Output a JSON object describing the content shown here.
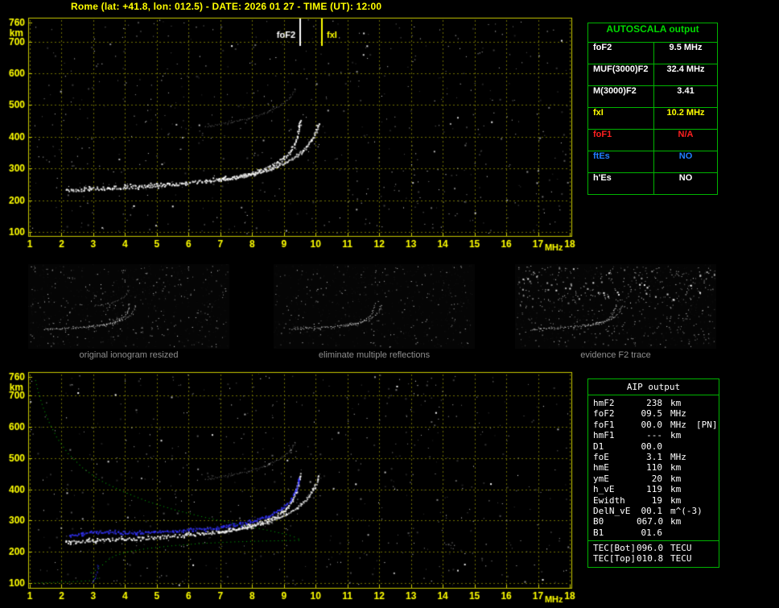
{
  "title": "Rome (lat: +41.8, lon: 012.5) - DATE: 2026 01 27 - TIME (UT): 12:00",
  "colors": {
    "background": "#000000",
    "axis_text": "#ffff00",
    "plot_border": "#c8c800",
    "grid": "#6e6e00",
    "table_green": "#00b400",
    "table_title_green": "#00d800",
    "trace_white": "#ffffff",
    "profile_green": "#00bb00",
    "trace_blue": "#3333ff",
    "caption_gray": "#8f8f8f",
    "red": "#ff2020",
    "blue": "#1f7fff",
    "yellow": "#ffff00"
  },
  "autoscala_table": {
    "title": "AUTOSCALA output",
    "rows": [
      {
        "key": "fof2",
        "label": "foF2",
        "value": "9.5 MHz",
        "color": "#ffffff"
      },
      {
        "key": "muf3000",
        "label": "MUF(3000)F2",
        "value": "32.4 MHz",
        "color": "#ffffff"
      },
      {
        "key": "m3000",
        "label": "M(3000)F2",
        "value": "3.41",
        "color": "#ffffff"
      },
      {
        "key": "fxi",
        "label": "fxI",
        "value": "10.2 MHz",
        "color": "#ffff00"
      },
      {
        "key": "fof1",
        "label": "foF1",
        "value": "N/A",
        "color": "#ff2020"
      },
      {
        "key": "ftes",
        "label": "ftEs",
        "value": "NO",
        "color": "#1f7fff"
      },
      {
        "key": "hes",
        "label": "h'Es",
        "value": "NO",
        "color": "#ffffff"
      }
    ]
  },
  "aip_table": {
    "title": "AIP output",
    "rows": [
      {
        "label": "hmF2",
        "value": "238",
        "unit": "km",
        "extra": ""
      },
      {
        "label": "foF2",
        "value": "09.5",
        "unit": "MHz",
        "extra": ""
      },
      {
        "label": "foF1",
        "value": "00.0",
        "unit": "MHz",
        "extra": "[PN]"
      },
      {
        "label": "hmF1",
        "value": "---",
        "unit": "km",
        "extra": ""
      },
      {
        "label": "D1",
        "value": "00.0",
        "unit": "",
        "extra": ""
      },
      {
        "label": "foE",
        "value": "3.1",
        "unit": "MHz",
        "extra": ""
      },
      {
        "label": "hmE",
        "value": "110",
        "unit": "km",
        "extra": ""
      },
      {
        "label": "ymE",
        "value": "20",
        "unit": "km",
        "extra": ""
      },
      {
        "label": "h_vE",
        "value": "119",
        "unit": "km",
        "extra": ""
      },
      {
        "label": "Ewidth",
        "value": "19",
        "unit": "km",
        "extra": ""
      },
      {
        "label": "DelN_vE",
        "value": "00.1",
        "unit": "m^(-3)",
        "extra": ""
      },
      {
        "label": "B0",
        "value": "067.0",
        "unit": "km",
        "extra": ""
      },
      {
        "label": "B1",
        "value": "01.6",
        "unit": "",
        "extra": ""
      }
    ],
    "tec_rows": [
      {
        "label": "TEC[Bot]",
        "value": "096.0",
        "unit": "TECU",
        "extra": ""
      },
      {
        "label": "TEC[Top]",
        "value": "010.8",
        "unit": "TECU",
        "extra": ""
      }
    ]
  },
  "thumbnails": [
    {
      "caption": "original ionogram resized",
      "seed": 77,
      "noise_count": 300,
      "top_noise_count": 0,
      "show": [
        "f2_ordinary",
        "f2_extraordinary",
        "multiple_reflection"
      ]
    },
    {
      "caption": "eliminate multiple reflections",
      "seed": 99,
      "noise_count": 210,
      "top_noise_count": 0,
      "show": [
        "f2_ordinary",
        "f2_extraordinary"
      ]
    },
    {
      "caption": "evidence F2 trace",
      "seed": 55,
      "noise_count": 380,
      "top_noise_count": 170,
      "show": [
        "f2_ordinary",
        "f2_extraordinary"
      ]
    }
  ],
  "chart_data": {
    "type": "scatter",
    "title": "ionogram",
    "xlabel": "MHz",
    "ylabel": "km",
    "x_range": [
      1,
      18
    ],
    "y_range": [
      100,
      775
    ],
    "x_ticks": [
      1,
      2,
      3,
      4,
      5,
      6,
      7,
      8,
      9,
      10,
      11,
      12,
      13,
      14,
      15,
      16,
      17,
      18
    ],
    "y_ticks": [
      760,
      700,
      600,
      500,
      400,
      300,
      200,
      100
    ],
    "grid": true,
    "annotations": [
      {
        "label": "foF2",
        "freq": 9.5,
        "color": "#ffffff",
        "side": "left"
      },
      {
        "label": "fxI",
        "freq": 10.2,
        "color": "#ffff00",
        "side": "right"
      }
    ],
    "traces": {
      "f2_ordinary": {
        "color": "#ffffff",
        "size": 2,
        "band": 4,
        "alpha": 0.95,
        "points": [
          [
            2.15,
            232
          ],
          [
            2.5,
            235
          ],
          [
            3.0,
            238
          ],
          [
            3.6,
            241
          ],
          [
            4.2,
            244
          ],
          [
            4.8,
            247
          ],
          [
            5.4,
            251
          ],
          [
            6.0,
            256
          ],
          [
            6.6,
            262
          ],
          [
            7.1,
            269
          ],
          [
            7.6,
            278
          ],
          [
            8.0,
            288
          ],
          [
            8.4,
            300
          ],
          [
            8.7,
            314
          ],
          [
            8.95,
            330
          ],
          [
            9.15,
            350
          ],
          [
            9.3,
            374
          ],
          [
            9.4,
            400
          ],
          [
            9.46,
            425
          ],
          [
            9.5,
            448
          ],
          [
            9.52,
            458
          ]
        ]
      },
      "f2_extraordinary": {
        "color": "#ffffff",
        "size": 2,
        "band": 2,
        "alpha": 0.8,
        "points": [
          [
            6.9,
            263
          ],
          [
            7.4,
            271
          ],
          [
            7.9,
            281
          ],
          [
            8.35,
            293
          ],
          [
            8.75,
            307
          ],
          [
            9.1,
            323
          ],
          [
            9.4,
            342
          ],
          [
            9.65,
            364
          ],
          [
            9.85,
            390
          ],
          [
            9.98,
            415
          ],
          [
            10.06,
            436
          ],
          [
            10.1,
            448
          ]
        ]
      },
      "multiple_reflection": {
        "color": "#b8b8b8",
        "size": 1,
        "band": 2,
        "alpha": 0.5,
        "points": [
          [
            6.5,
            432
          ],
          [
            7.0,
            440
          ],
          [
            7.5,
            450
          ],
          [
            8.0,
            462
          ],
          [
            8.4,
            476
          ],
          [
            8.75,
            492
          ],
          [
            9.05,
            512
          ],
          [
            9.25,
            533
          ],
          [
            9.38,
            555
          ]
        ]
      },
      "profile_topside": {
        "color": "#00bb00",
        "size": 1,
        "dotted": true,
        "points": [
          [
            1.15,
            758
          ],
          [
            1.25,
            715
          ],
          [
            1.4,
            665
          ],
          [
            1.6,
            615
          ],
          [
            1.85,
            565
          ],
          [
            2.2,
            515
          ],
          [
            2.65,
            470
          ],
          [
            3.2,
            430
          ],
          [
            3.9,
            395
          ],
          [
            4.7,
            362
          ],
          [
            5.6,
            334
          ],
          [
            6.6,
            309
          ],
          [
            7.6,
            288
          ],
          [
            8.5,
            270
          ],
          [
            9.1,
            256
          ],
          [
            9.4,
            246
          ],
          [
            9.5,
            239
          ]
        ]
      },
      "profile_bottomside": {
        "color": "#00bb00",
        "size": 1,
        "dotted": true,
        "points": [
          [
            1.05,
            101
          ],
          [
            1.7,
            103
          ],
          [
            2.4,
            106
          ],
          [
            2.95,
            109
          ],
          [
            3.1,
            111
          ],
          [
            3.12,
            116
          ],
          [
            2.98,
            121
          ],
          [
            2.88,
            127
          ],
          [
            2.92,
            134
          ],
          [
            3.05,
            142
          ],
          [
            3.2,
            152
          ],
          [
            3.32,
            163
          ],
          [
            3.45,
            176
          ],
          [
            3.7,
            190
          ],
          [
            4.1,
            202
          ],
          [
            4.7,
            212
          ],
          [
            5.5,
            221
          ],
          [
            6.4,
            228
          ],
          [
            7.4,
            233
          ],
          [
            8.4,
            236
          ],
          [
            9.1,
            237
          ],
          [
            9.5,
            238
          ]
        ]
      },
      "restored_trace_blue": {
        "color": "#3333ff",
        "size": 2,
        "band": 3,
        "alpha": 0.9,
        "points": [
          [
            2.25,
            252
          ],
          [
            2.5,
            258
          ],
          [
            2.8,
            263
          ],
          [
            3.2,
            265
          ],
          [
            3.7,
            264
          ],
          [
            4.3,
            263
          ],
          [
            4.9,
            265
          ],
          [
            5.5,
            268
          ],
          [
            6.1,
            272
          ],
          [
            6.7,
            277
          ],
          [
            7.2,
            284
          ],
          [
            7.7,
            293
          ],
          [
            8.1,
            303
          ],
          [
            8.5,
            316
          ],
          [
            8.8,
            332
          ],
          [
            9.05,
            352
          ],
          [
            9.25,
            376
          ],
          [
            9.38,
            402
          ],
          [
            9.45,
            428
          ],
          [
            9.48,
            445
          ]
        ]
      },
      "restored_trace_blue_e": {
        "color": "#3333ff",
        "size": 1,
        "band": 2,
        "alpha": 0.9,
        "points": [
          [
            3.0,
            106
          ],
          [
            3.05,
            118
          ],
          [
            3.1,
            132
          ],
          [
            3.15,
            148
          ],
          [
            3.1,
            163
          ]
        ]
      }
    },
    "top_plot": {
      "noise_seed": 101,
      "noise_count": 540,
      "annotations": true,
      "show": [
        "multiple_reflection",
        "f2_ordinary",
        "f2_extraordinary"
      ]
    },
    "bottom_plot": {
      "noise_seed": 202,
      "noise_count": 540,
      "annotations": false,
      "show": [
        "multiple_reflection",
        "profile_topside",
        "profile_bottomside",
        "f2_ordinary",
        "f2_extraordinary",
        "restored_trace_blue",
        "restored_trace_blue_e"
      ]
    }
  }
}
